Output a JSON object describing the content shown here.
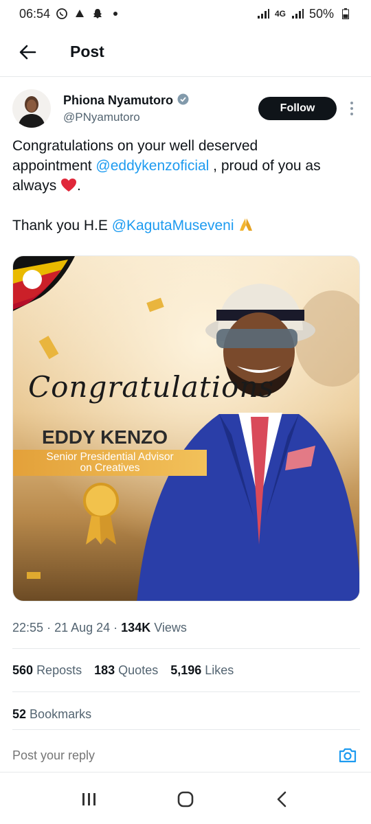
{
  "status_bar": {
    "time": "06:54",
    "network": "4G",
    "battery": "50%"
  },
  "header": {
    "title": "Post"
  },
  "author": {
    "name": "Phiona Nyamutoro",
    "handle": "@PNyamutoro",
    "verified": true,
    "follow_label": "Follow"
  },
  "tweet": {
    "line1": "Congratulations on your well deserved",
    "line2_pre": "appointment ",
    "mention1": "@eddykenzoficial",
    "line2_post": " , proud of you as",
    "line3": "always",
    "line3_after": ".",
    "line4_pre": "Thank you H.E ",
    "mention2": "@KagutaMuseveni"
  },
  "media": {
    "script_text": "Congratulations",
    "name_text": "EDDY KENZO",
    "band_line1": "Senior Presidential Advisor",
    "band_line2": "on Creatives"
  },
  "meta": {
    "time": "22:55",
    "date": "21 Aug 24",
    "views_count": "134K",
    "views_label": "Views"
  },
  "stats": {
    "reposts_count": "560",
    "reposts_label": "Reposts",
    "quotes_count": "183",
    "quotes_label": "Quotes",
    "likes_count": "5,196",
    "likes_label": "Likes",
    "bookmarks_count": "52",
    "bookmarks_label": "Bookmarks"
  },
  "reply": {
    "placeholder": "Post your reply"
  },
  "colors": {
    "accent": "#1d9bf0",
    "text": "#0f1419",
    "secondary": "#536471",
    "follow_bg": "#0f1419",
    "band": "#e5a23a"
  }
}
